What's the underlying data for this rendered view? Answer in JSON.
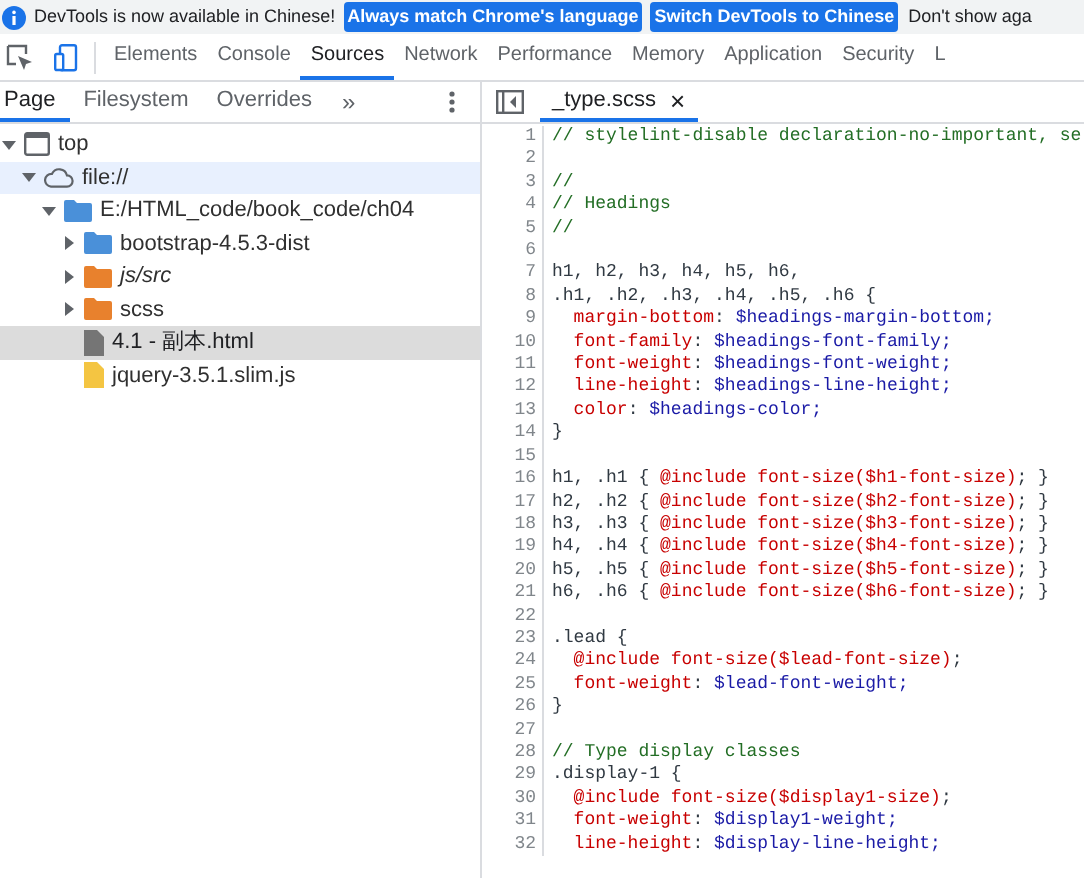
{
  "infobar": {
    "message": "DevTools is now available in Chinese!",
    "buttons": [
      "Always match Chrome's language",
      "Switch DevTools to Chinese"
    ],
    "dismiss": "Don't show aga"
  },
  "main_tabs": [
    {
      "label": "Elements",
      "selected": false
    },
    {
      "label": "Console",
      "selected": false
    },
    {
      "label": "Sources",
      "selected": true
    },
    {
      "label": "Network",
      "selected": false
    },
    {
      "label": "Performance",
      "selected": false
    },
    {
      "label": "Memory",
      "selected": false
    },
    {
      "label": "Application",
      "selected": false
    },
    {
      "label": "Security",
      "selected": false
    },
    {
      "label": "L",
      "selected": false
    }
  ],
  "navigator_tabs": [
    {
      "label": "Page",
      "selected": true
    },
    {
      "label": "Filesystem",
      "selected": false
    },
    {
      "label": "Overrides",
      "selected": false
    }
  ],
  "navigator_more": "»",
  "tree": [
    {
      "kind": "frame",
      "label": "top",
      "expanded": true,
      "selected": false,
      "hovered": false,
      "children": [
        {
          "kind": "origin",
          "label": "file://",
          "expanded": true,
          "selected": false,
          "hovered": true,
          "children": [
            {
              "kind": "folder",
              "label": "E:/HTML_code/book_code/ch04",
              "color": "#4a90d9",
              "expanded": true,
              "selected": false,
              "hovered": false,
              "children": [
                {
                  "kind": "folder",
                  "label": "bootstrap-4.5.3-dist",
                  "color": "#4a90d9",
                  "expanded": false,
                  "selected": false,
                  "hovered": false
                },
                {
                  "kind": "folder",
                  "label": "js/src",
                  "color": "#e8812d",
                  "expanded": false,
                  "selected": false,
                  "hovered": false,
                  "ignored": true
                },
                {
                  "kind": "folder",
                  "label": "scss",
                  "color": "#e8812d",
                  "expanded": false,
                  "selected": false,
                  "hovered": false
                },
                {
                  "kind": "file",
                  "label": "4.1 - 副本.html",
                  "color": "#757575",
                  "selected": true,
                  "hovered": false
                },
                {
                  "kind": "file",
                  "label": "jquery-3.5.1.slim.js",
                  "color": "#f4c542",
                  "selected": false,
                  "hovered": false
                }
              ]
            }
          ]
        }
      ]
    }
  ],
  "editor_tab": {
    "label": "_type.scss",
    "close": "×"
  },
  "code": [
    {
      "number": "1",
      "tokens": [
        {
          "kind": "comment",
          "text": "// stylelint-disable declaration-no-important, se"
        }
      ]
    },
    {
      "number": "2"
    },
    {
      "number": "3",
      "tokens": [
        {
          "kind": "comment",
          "text": "//"
        }
      ]
    },
    {
      "number": "4",
      "tokens": [
        {
          "kind": "comment",
          "text": "// Headings"
        }
      ]
    },
    {
      "number": "5",
      "tokens": [
        {
          "kind": "comment",
          "text": "//"
        }
      ]
    },
    {
      "number": "6"
    },
    {
      "number": "7",
      "tokens": [
        {
          "kind": "plain",
          "text": "h1, h2, h3, h4, h5, h6,"
        }
      ]
    },
    {
      "number": "8",
      "tokens": [
        {
          "kind": "plain",
          "text": ".h1, .h2, .h3, .h4, .h5, .h6 {"
        }
      ]
    },
    {
      "number": "9",
      "tokens": [
        {
          "kind": "property",
          "text": "  margin-bottom"
        },
        {
          "kind": "plain",
          "text": ": "
        },
        {
          "kind": "value",
          "text": "$headings-margin-bottom;"
        }
      ]
    },
    {
      "number": "10",
      "tokens": [
        {
          "kind": "property",
          "text": "  font-family"
        },
        {
          "kind": "plain",
          "text": ": "
        },
        {
          "kind": "value",
          "text": "$headings-font-family;"
        }
      ]
    },
    {
      "number": "11",
      "tokens": [
        {
          "kind": "property",
          "text": "  font-weight"
        },
        {
          "kind": "plain",
          "text": ": "
        },
        {
          "kind": "value",
          "text": "$headings-font-weight;"
        }
      ]
    },
    {
      "number": "12",
      "tokens": [
        {
          "kind": "property",
          "text": "  line-height"
        },
        {
          "kind": "plain",
          "text": ": "
        },
        {
          "kind": "value",
          "text": "$headings-line-height;"
        }
      ]
    },
    {
      "number": "13",
      "tokens": [
        {
          "kind": "property",
          "text": "  color"
        },
        {
          "kind": "plain",
          "text": ": "
        },
        {
          "kind": "value",
          "text": "$headings-color;"
        }
      ]
    },
    {
      "number": "14",
      "tokens": [
        {
          "kind": "plain",
          "text": "}"
        }
      ]
    },
    {
      "number": "15"
    },
    {
      "number": "16",
      "tokens": [
        {
          "kind": "plain",
          "text": "h1, .h1 { "
        },
        {
          "kind": "property",
          "text": "@include font-size($h1-font-size)"
        },
        {
          "kind": "plain",
          "text": "; }"
        }
      ]
    },
    {
      "number": "17",
      "tokens": [
        {
          "kind": "plain",
          "text": "h2, .h2 { "
        },
        {
          "kind": "property",
          "text": "@include font-size($h2-font-size)"
        },
        {
          "kind": "plain",
          "text": "; }"
        }
      ]
    },
    {
      "number": "18",
      "tokens": [
        {
          "kind": "plain",
          "text": "h3, .h3 { "
        },
        {
          "kind": "property",
          "text": "@include font-size($h3-font-size)"
        },
        {
          "kind": "plain",
          "text": "; }"
        }
      ]
    },
    {
      "number": "19",
      "tokens": [
        {
          "kind": "plain",
          "text": "h4, .h4 { "
        },
        {
          "kind": "property",
          "text": "@include font-size($h4-font-size)"
        },
        {
          "kind": "plain",
          "text": "; }"
        }
      ]
    },
    {
      "number": "20",
      "tokens": [
        {
          "kind": "plain",
          "text": "h5, .h5 { "
        },
        {
          "kind": "property",
          "text": "@include font-size($h5-font-size)"
        },
        {
          "kind": "plain",
          "text": "; }"
        }
      ]
    },
    {
      "number": "21",
      "tokens": [
        {
          "kind": "plain",
          "text": "h6, .h6 { "
        },
        {
          "kind": "property",
          "text": "@include font-size($h6-font-size)"
        },
        {
          "kind": "plain",
          "text": "; }"
        }
      ]
    },
    {
      "number": "22"
    },
    {
      "number": "23",
      "tokens": [
        {
          "kind": "plain",
          "text": ".lead {"
        }
      ]
    },
    {
      "number": "24",
      "tokens": [
        {
          "kind": "property",
          "text": "  @include font-size($lead-font-size)"
        },
        {
          "kind": "plain",
          "text": ";"
        }
      ]
    },
    {
      "number": "25",
      "tokens": [
        {
          "kind": "property",
          "text": "  font-weight"
        },
        {
          "kind": "plain",
          "text": ": "
        },
        {
          "kind": "value",
          "text": "$lead-font-weight;"
        }
      ]
    },
    {
      "number": "26",
      "tokens": [
        {
          "kind": "plain",
          "text": "}"
        }
      ]
    },
    {
      "number": "27"
    },
    {
      "number": "28",
      "tokens": [
        {
          "kind": "comment",
          "text": "// Type display classes"
        }
      ]
    },
    {
      "number": "29",
      "tokens": [
        {
          "kind": "plain",
          "text": ".display-1 {"
        }
      ]
    },
    {
      "number": "30",
      "tokens": [
        {
          "kind": "property",
          "text": "  @include font-size($display1-size)"
        },
        {
          "kind": "plain",
          "text": ";"
        }
      ]
    },
    {
      "number": "31",
      "tokens": [
        {
          "kind": "property",
          "text": "  font-weight"
        },
        {
          "kind": "plain",
          "text": ": "
        },
        {
          "kind": "value",
          "text": "$display1-weight;"
        }
      ]
    },
    {
      "number": "32",
      "tokens": [
        {
          "kind": "property",
          "text": "  line-height"
        },
        {
          "kind": "plain",
          "text": ": "
        },
        {
          "kind": "value",
          "text": "$display-line-height;"
        }
      ]
    }
  ]
}
